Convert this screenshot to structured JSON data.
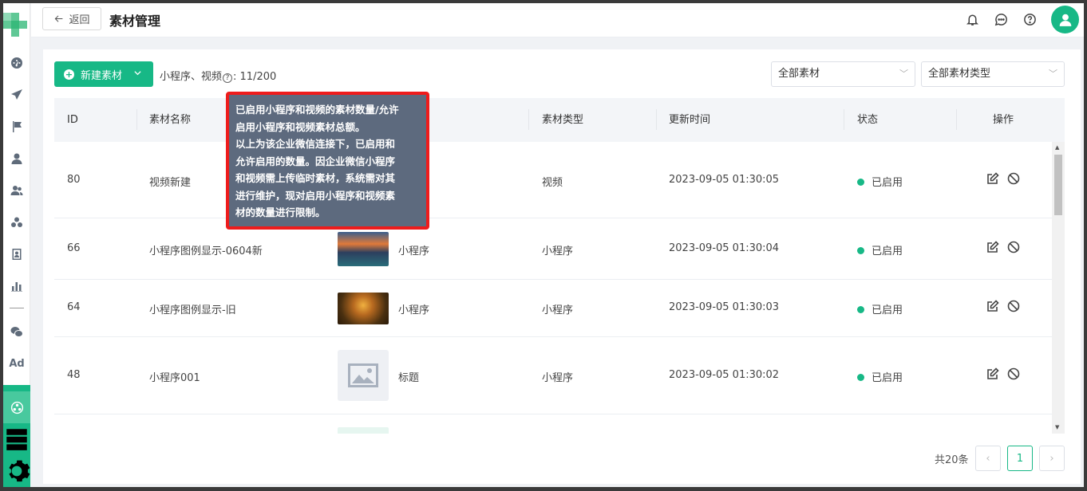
{
  "header": {
    "back_label": "返回",
    "title": "素材管理"
  },
  "sidebar": {
    "icons": [
      "dashboard-icon",
      "send-icon",
      "flag-icon",
      "user-icon",
      "users-icon",
      "cluster-icon",
      "contact-icon",
      "bar-chart-icon",
      "wechat-icon"
    ],
    "ad_label": "Ad",
    "green_icons": [
      "material-icon",
      "storage-icon",
      "settings-icon"
    ]
  },
  "toolbar": {
    "new_label": "新建素材",
    "quota_text_prefix": "小程序、视频",
    "quota_value": ": 11/200",
    "filter_all": "全部素材",
    "filter_type": "全部素材类型"
  },
  "table": {
    "headers": [
      "ID",
      "素材名称",
      "素材类型",
      "更新时间",
      "状态",
      "操作"
    ],
    "rows": [
      {
        "id": "80",
        "name": "视频新建",
        "preview_label": "",
        "type": "视频",
        "updated": "2023-09-05 01:30:05",
        "status": "已启用"
      },
      {
        "id": "66",
        "name": "小程序图例显示-0604新",
        "preview_label": "小程序",
        "type": "小程序",
        "updated": "2023-09-05 01:30:04",
        "status": "已启用"
      },
      {
        "id": "64",
        "name": "小程序图例显示-旧",
        "preview_label": "小程序",
        "type": "小程序",
        "updated": "2023-09-05 01:30:03",
        "status": "已启用"
      },
      {
        "id": "48",
        "name": "小程序001",
        "preview_label": "标题",
        "type": "小程序",
        "updated": "2023-09-05 01:30:02",
        "status": "已启用"
      }
    ]
  },
  "pagination": {
    "total": "共20条",
    "prev": "‹",
    "current": "1",
    "next": "›"
  },
  "tooltip": {
    "lines": [
      "已启用小程序和视频的素材数量/允许",
      "启用小程序和视频素材总额。",
      "以上为该企业微信连接下，已启用和",
      "允许启用的数量。因企业微信小程序",
      "和视频需上传临时素材，系统需对其",
      "进行维护，现对启用小程序和视频素",
      "材的数量进行限制。"
    ]
  },
  "colors": {
    "accent": "#17b886",
    "tooltip_bg": "#5d6a7e",
    "highlight_border": "#ee1c1c"
  }
}
